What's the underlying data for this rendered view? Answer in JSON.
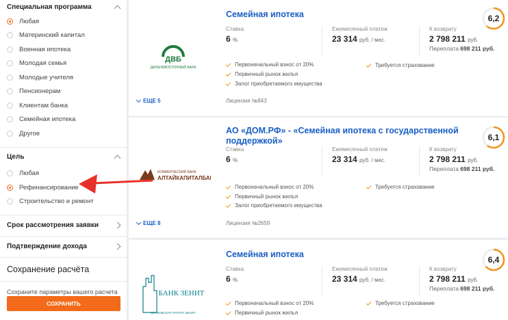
{
  "sidebar": {
    "special": {
      "title": "Специальная программа",
      "items": [
        {
          "label": "Любая",
          "checked": true
        },
        {
          "label": "Материнский капитал",
          "checked": false
        },
        {
          "label": "Военная ипотека",
          "checked": false
        },
        {
          "label": "Молодая семья",
          "checked": false
        },
        {
          "label": "Молодые учителя",
          "checked": false
        },
        {
          "label": "Пенсионерам",
          "checked": false
        },
        {
          "label": "Клиентам банка",
          "checked": false
        },
        {
          "label": "Семейная ипотека",
          "checked": false
        },
        {
          "label": "Другое",
          "checked": false
        }
      ]
    },
    "goal": {
      "title": "Цель",
      "items": [
        {
          "label": "Любая",
          "checked": false
        },
        {
          "label": "Рефинансирование",
          "checked": true
        },
        {
          "label": "Строительство и ремонт",
          "checked": false
        }
      ]
    },
    "review_term": "Срок рассмотрения заявки",
    "income_proof": "Подтверждение дохода",
    "save": {
      "title": "Сохранение расчёта",
      "text": "Сохраните параметры вашего расчета",
      "button": "Сохранить"
    }
  },
  "offers": [
    {
      "title": "Семейная ипотека",
      "bank_logo_text": "ДВБ",
      "bank_logo_sub": "ДАЛЬНЕВОСТОЧНЫЙ БАНК",
      "rate_label": "Ставка",
      "rate_value": "6",
      "rate_unit": "%",
      "payment_label": "Ежемесячный платеж",
      "payment_value": "23 314",
      "payment_unit": "руб. / мес.",
      "repay_label": "К возврату",
      "repay_value": "2 798 211",
      "repay_unit": "руб.",
      "overpay_label": "Переплата",
      "overpay_value": "698 211 руб.",
      "features": [
        "Первоначальный взнос от 20%",
        "Первичный рынок жилья",
        "Залог приобретаемого имущества"
      ],
      "extra_feature": "Требуется страхование",
      "more": "ЕЩЕ 5",
      "license": "Лицензия №843",
      "rating": "6,2"
    },
    {
      "title": "АО «ДОМ.РФ» - «Семейная ипотека с государственной поддержкой»",
      "bank_logo_text": "АЛТАЙКАПИТАЛБАНК",
      "bank_logo_sub": "КОММЕРЧЕСКИЙ БАНК",
      "rate_label": "Ставка",
      "rate_value": "6",
      "rate_unit": "%",
      "payment_label": "Ежемесячный платеж",
      "payment_value": "23 314",
      "payment_unit": "руб. / мес.",
      "repay_label": "К возврату",
      "repay_value": "2 798 211",
      "repay_unit": "руб.",
      "overpay_label": "Переплата",
      "overpay_value": "698 211 руб.",
      "features": [
        "Первоначальный взнос от 20%",
        "Первичный рынок жилья",
        "Залог приобретаемого имущества"
      ],
      "extra_feature": "Требуется страхование",
      "more": "ЕЩЕ 8",
      "license": "Лицензия №2659",
      "rating": "6,1"
    },
    {
      "title": "Семейная ипотека",
      "bank_logo_text": "БАНК ЗЕНИТ",
      "bank_logo_sub": "БАНКОВСКАЯ ГРУППА ЗЕНИТ",
      "rate_label": "Ставка",
      "rate_value": "6",
      "rate_unit": "%",
      "payment_label": "Ежемесячный платеж",
      "payment_value": "23 314",
      "payment_unit": "руб. / мес.",
      "repay_label": "К возврату",
      "repay_value": "2 798 211",
      "repay_unit": "руб.",
      "overpay_label": "Переплата",
      "overpay_value": "698 211 руб.",
      "features": [
        "Первоначальный взнос от 20%",
        "Первичный рынок жилья"
      ],
      "extra_feature": "Требуется страхование",
      "more": "",
      "license": "",
      "rating": "6,4"
    }
  ],
  "colors": {
    "accent": "#f26a1a",
    "link": "#1a5fc4",
    "annotation": "#e8312a"
  }
}
